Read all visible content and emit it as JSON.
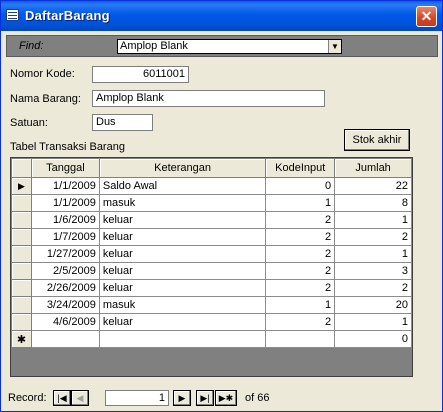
{
  "window": {
    "title": "DaftarBarang",
    "close_glyph": "✕"
  },
  "find": {
    "label": "Find:",
    "value": "Amplop Blank",
    "arrow": "▼"
  },
  "form": {
    "nomor_kode_label": "Nomor Kode:",
    "nomor_kode_value": "6011001",
    "nama_barang_label": "Nama Barang:",
    "nama_barang_value": "Amplop Blank",
    "satuan_label": "Satuan:",
    "satuan_value": "Dus",
    "stok_button_label": "Stok akhir",
    "table_caption": "Tabel Transaksi Barang"
  },
  "table": {
    "columns": [
      "Tanggal",
      "Keterangan",
      "KodeInput",
      "Jumlah"
    ],
    "current_row_marker": "▶",
    "new_row_marker": "✱",
    "rows": [
      [
        "1/1/2009",
        "Saldo Awal",
        "0",
        "22"
      ],
      [
        "1/1/2009",
        "masuk",
        "1",
        "8"
      ],
      [
        "1/6/2009",
        "keluar",
        "2",
        "1"
      ],
      [
        "1/7/2009",
        "keluar",
        "2",
        "2"
      ],
      [
        "1/27/2009",
        "keluar",
        "2",
        "1"
      ],
      [
        "2/5/2009",
        "keluar",
        "2",
        "3"
      ],
      [
        "2/26/2009",
        "keluar",
        "2",
        "2"
      ],
      [
        "3/24/2009",
        "masuk",
        "1",
        "20"
      ],
      [
        "4/6/2009",
        "keluar",
        "2",
        "1"
      ]
    ],
    "new_row_jumlah": "0"
  },
  "navigation": {
    "label": "Record:",
    "current": "1",
    "of_label": "of",
    "total": "66",
    "first_glyph": "|◀",
    "prev_glyph": "◀",
    "next_glyph": "▶",
    "last_glyph": "▶|",
    "new_glyph": "▶✱"
  },
  "icons": {
    "window": "form-icon",
    "close": "close-icon",
    "dropdown": "chevron-down-icon"
  },
  "colors": {
    "titlebar": "#0058e6",
    "close": "#d5482a",
    "face": "#ece9d8",
    "findbar": "#808080"
  }
}
